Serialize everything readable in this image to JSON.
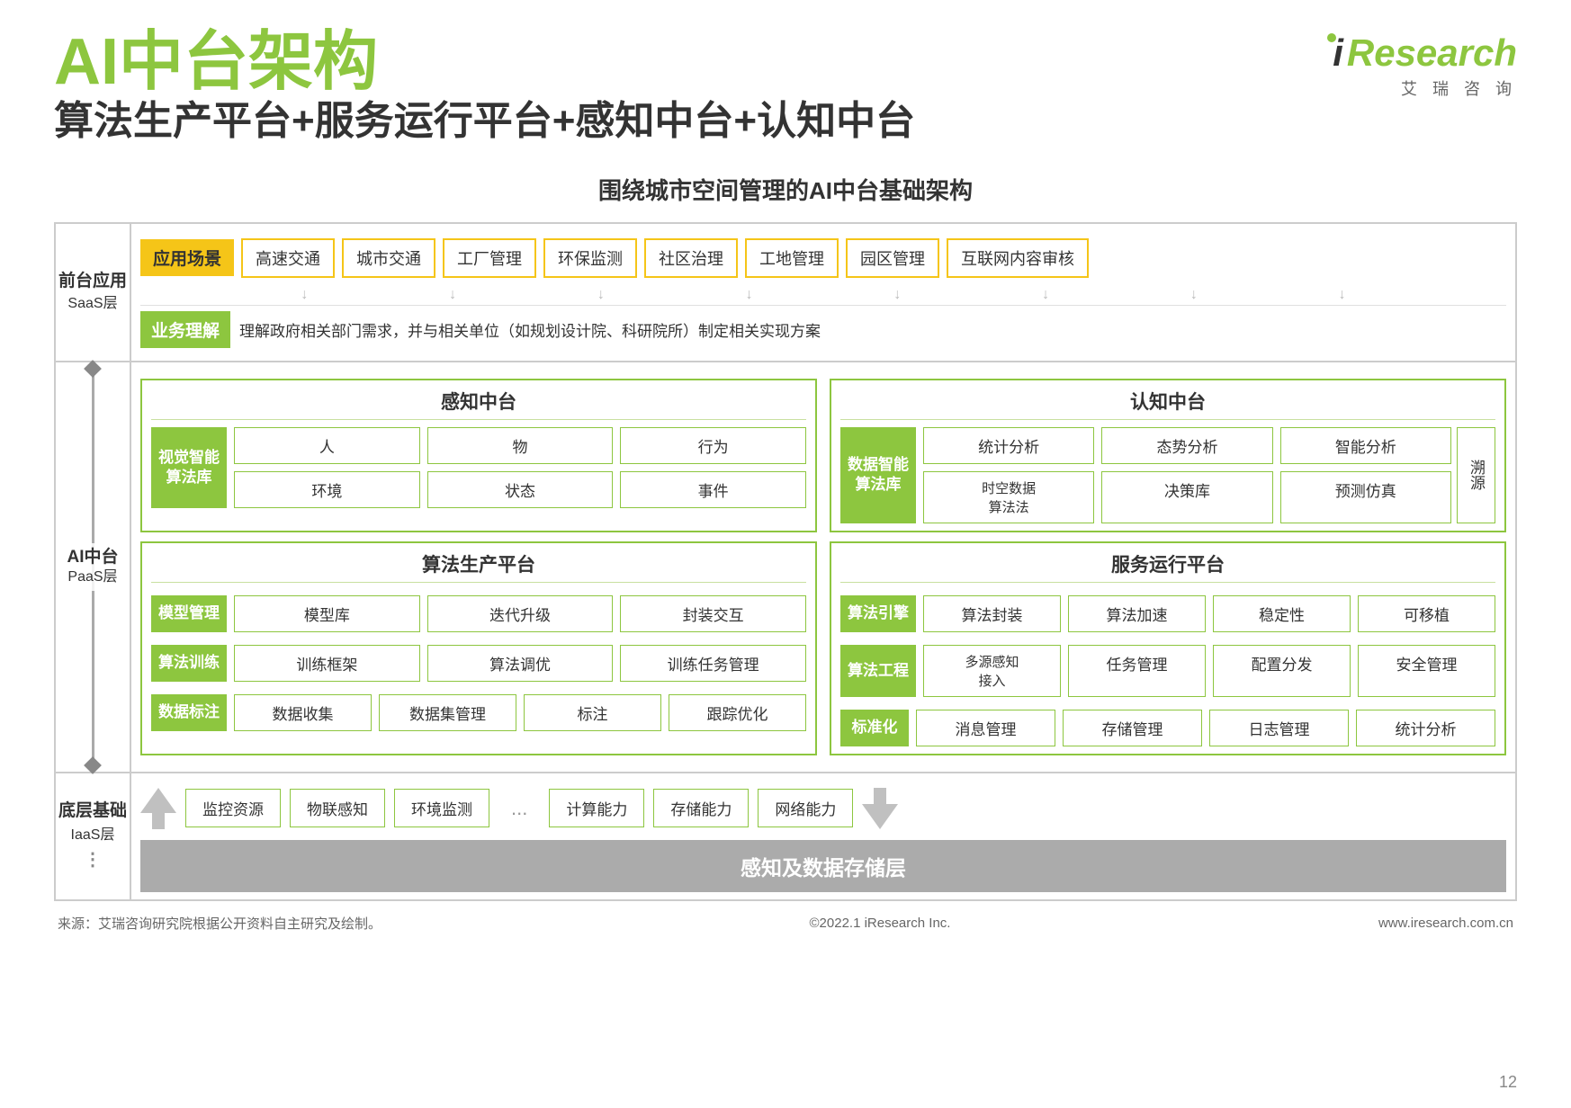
{
  "page": {
    "title": "AI中台架构",
    "subtitle": "算法生产平台+服务运行平台+感知中台+认知中台",
    "diagram_title": "围绕城市空间管理的AI中台基础架构"
  },
  "logo": {
    "i": "i",
    "research": "Research",
    "cn": "艾  瑞  咨  询"
  },
  "labels": {
    "qiantai": "前台应用",
    "saas": "SaaS层",
    "aizh": "AI中台",
    "paas": "PaaS层",
    "diceng": "底层基础",
    "iaas": "IaaS层"
  },
  "saas": {
    "tag": "应用场景",
    "items": [
      "高速交通",
      "城市交通",
      "工厂管理",
      "环保监测",
      "社区治理",
      "工地管理",
      "园区管理",
      "互联网内容审核"
    ],
    "biz_tag": "业务理解",
    "biz_text": "理解政府相关部门需求，并与相关单位（如规划设计院、科研院所）制定相关实现方案"
  },
  "paas": {
    "left_box": {
      "title": "感知中台",
      "algo_lib": "视觉智能\n算法库",
      "row1": [
        "人",
        "物",
        "行为"
      ],
      "row2": [
        "环境",
        "状态",
        "事件"
      ]
    },
    "right_box": {
      "title": "认知中台",
      "algo_lib": "数据智能\n算法库",
      "row1": [
        "统计分析",
        "态势分析",
        "智能分析"
      ],
      "row2_label": "时空数据\n算法法",
      "row2_item1": "时空数据\n算法法",
      "row2": [
        "决策库",
        "预测仿真"
      ],
      "suiyuan": "溯源"
    },
    "algo_platform": {
      "title": "算法生产平台",
      "rows": [
        {
          "label": "模型管理",
          "items": [
            "模型库",
            "迭代升级",
            "封装交互"
          ]
        },
        {
          "label": "算法训练",
          "items": [
            "训练框架",
            "算法调优",
            "训练任务管理"
          ]
        },
        {
          "label": "数据标注",
          "items": [
            "数据收集",
            "数据集管理",
            "标注",
            "跟踪优化"
          ]
        }
      ]
    },
    "service_platform": {
      "title": "服务运行平台",
      "rows": [
        {
          "label": "算法引擎",
          "items": [
            "算法封装",
            "算法加速",
            "稳定性",
            "可移植"
          ]
        },
        {
          "label": "算法工程",
          "items2": [
            {
              "label": "多源感知\n接入"
            },
            "任务管理",
            "配置分发",
            "安全管理"
          ]
        },
        {
          "label": "标准化",
          "items": [
            "消息管理",
            "存储管理",
            "日志管理",
            "统计分析"
          ]
        }
      ]
    }
  },
  "iaas": {
    "items": [
      "监控资源",
      "物联感知",
      "环境监测",
      "...",
      "计算能力",
      "存储能力",
      "网络能力"
    ],
    "bottom": "感知及数据存储层"
  },
  "footer": {
    "source": "来源：艾瑞咨询研究院根据公开资料自主研究及绘制。",
    "copyright": "©2022.1 iResearch Inc.",
    "url": "www.iresearch.com.cn",
    "page_num": "12"
  }
}
